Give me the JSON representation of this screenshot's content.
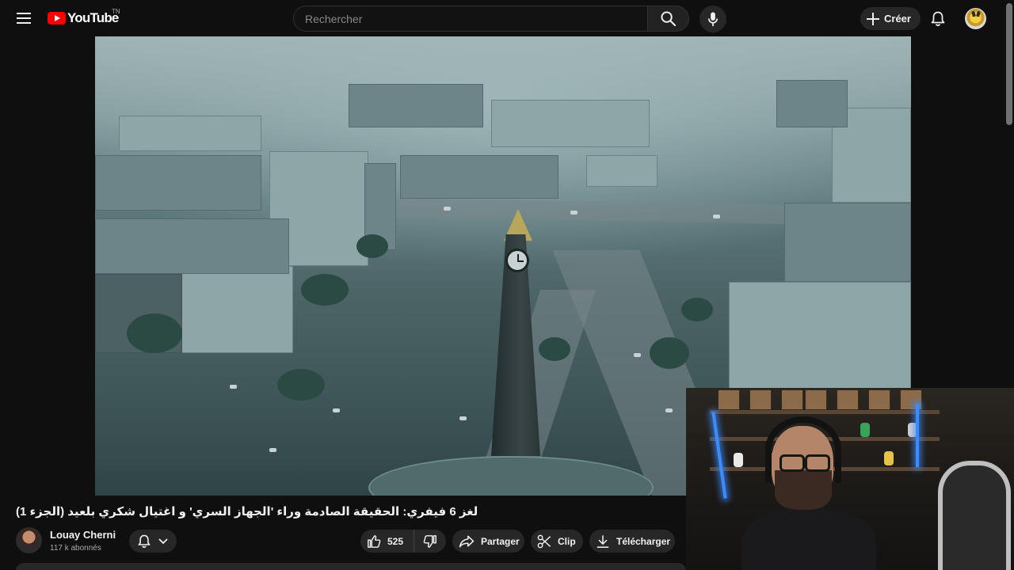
{
  "header": {
    "logo_text": "YouTube",
    "region_code": "TN",
    "search_placeholder": "Rechercher",
    "create_label": "Créer"
  },
  "icons": {
    "menu": "hamburger-menu-icon",
    "search": "search-icon",
    "mic": "microphone-icon",
    "create": "plus-icon",
    "notifications": "bell-icon",
    "like": "thumbs-up-icon",
    "dislike": "thumbs-down-icon",
    "share": "share-arrow-icon",
    "clip": "scissors-icon",
    "download": "download-icon"
  },
  "video": {
    "title": "لغز 6 فيفري: الحقيقة الصادمة وراء 'الجهاز السري' و اغتيال شكري بلعيد (الجزء 1)"
  },
  "channel": {
    "name": "Louay Cherni",
    "subscribers": "117 k abonnés"
  },
  "actions": {
    "like_count": "525",
    "share_label": "Partager",
    "clip_label": "Clip",
    "download_label": "Télécharger"
  },
  "colors": {
    "background": "#0f0f0f",
    "pill": "#272727",
    "brand_red": "#ff0000",
    "text": "#f1f1f1",
    "secondary_text": "#aaaaaa"
  }
}
